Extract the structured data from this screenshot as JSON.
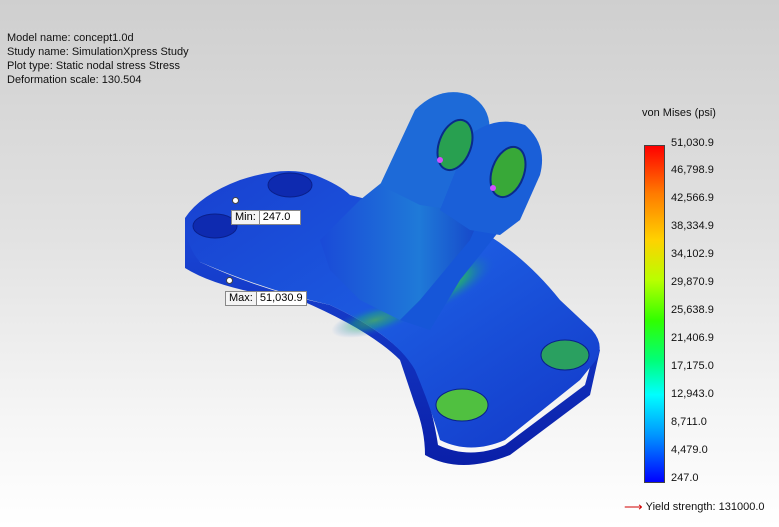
{
  "info": {
    "model": "Model name: concept1.0d",
    "study": "Study name: SimulationXpress Study",
    "plot": "Plot type: Static nodal stress Stress",
    "deformation": "Deformation scale: 130.504"
  },
  "probes": {
    "min": {
      "label": "Min:",
      "value": "247.0"
    },
    "max": {
      "label": "Max:",
      "value": "51,030.9"
    }
  },
  "legend": {
    "title": "von Mises (psi)",
    "ticks": [
      "51,030.9",
      "46,798.9",
      "42,566.9",
      "38,334.9",
      "34,102.9",
      "29,870.9",
      "25,638.9",
      "21,406.9",
      "17,175.0",
      "12,943.0",
      "8,711.0",
      "4,479.0",
      "247.0"
    ],
    "colors": {
      "high": "#ff0000",
      "mid": "#30ff00",
      "low": "#0000ff"
    }
  },
  "yield": {
    "text": "Yield strength: 131000.0",
    "arrow_icon": "red-arrow-icon"
  }
}
